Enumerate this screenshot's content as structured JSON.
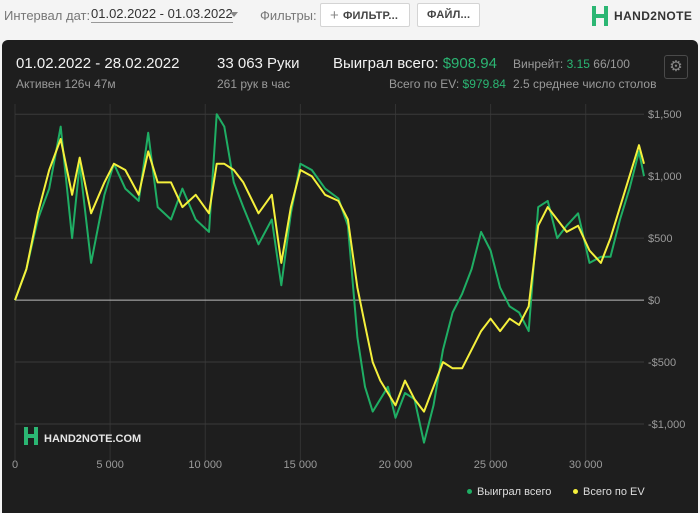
{
  "toolbar": {
    "interval_label": "Интервал дат:",
    "date_range": "01.02.2022 - 01.03.2022",
    "filters_label": "Фильтры:",
    "filter_button": "ФИЛЬТР...",
    "files_button": "ФАЙЛ...",
    "logo_text": "HAND2NOTE"
  },
  "stats": {
    "period": "01.02.2022 - 28.02.2022",
    "active": "Активен 126ч 47м",
    "hands": "33 063 Руки",
    "hands_per_hour": "261 рук в час",
    "won_label": "Выиграл всего:",
    "won_value": "$908.94",
    "ev_label": "Всего по EV:",
    "ev_value": "$979.84",
    "winrate_label": "Винрейт:",
    "winrate_value": "3.15",
    "winrate_unit": "66/100",
    "avg_tables": "2.5 среднее число столов"
  },
  "watermark": "HAND2NOTE.COM",
  "legend": {
    "won": "Выиграл всего",
    "ev": "Всего по EV"
  },
  "colors": {
    "won": "#1fae64",
    "ev": "#f5f03c",
    "background": "#1e1e1e"
  },
  "chart_data": {
    "type": "line",
    "xlim": [
      0,
      33063
    ],
    "ylim": [
      -1250,
      1550
    ],
    "x_ticks": [
      0,
      5000,
      10000,
      15000,
      20000,
      25000,
      30000
    ],
    "x_tick_labels": [
      "0",
      "5 000",
      "10 000",
      "15 000",
      "20 000",
      "25 000",
      "30 000"
    ],
    "y_ticks": [
      1500,
      1000,
      500,
      0,
      -500,
      -1000
    ],
    "y_tick_labels": [
      "$1,500",
      "$1,000",
      "$500",
      "$0",
      "-$500",
      "-$1,000"
    ],
    "grid": true,
    "legend_position": "bottom-right",
    "series": [
      {
        "name": "Выиграл всего",
        "x": [
          0,
          600,
          1200,
          1800,
          2400,
          3000,
          3400,
          4000,
          4700,
          5200,
          5800,
          6500,
          7000,
          7500,
          8200,
          8800,
          9500,
          10200,
          10600,
          11000,
          11500,
          12000,
          12800,
          13500,
          14000,
          14500,
          15000,
          15600,
          16300,
          17000,
          17500,
          18000,
          18400,
          18800,
          19200,
          19600,
          20000,
          20500,
          21000,
          21500,
          22000,
          22500,
          23000,
          23500,
          24000,
          24500,
          25000,
          25500,
          26000,
          26500,
          27000,
          27500,
          28000,
          28500,
          29000,
          29600,
          30200,
          30800,
          31300,
          31800,
          32300,
          32800,
          33063
        ],
        "values": [
          0,
          250,
          650,
          900,
          1400,
          500,
          1100,
          300,
          850,
          1100,
          900,
          800,
          1350,
          750,
          650,
          900,
          650,
          550,
          1500,
          1400,
          950,
          750,
          450,
          650,
          120,
          700,
          1100,
          1050,
          900,
          820,
          600,
          -300,
          -700,
          -900,
          -800,
          -700,
          -950,
          -750,
          -800,
          -1150,
          -850,
          -400,
          -100,
          50,
          250,
          550,
          400,
          100,
          -50,
          -100,
          -250,
          750,
          800,
          500,
          600,
          700,
          300,
          350,
          350,
          650,
          900,
          1200,
          1000
        ]
      },
      {
        "name": "Всего по EV",
        "x": [
          0,
          600,
          1200,
          1800,
          2400,
          3000,
          3400,
          4000,
          4700,
          5200,
          5800,
          6500,
          7000,
          7500,
          8200,
          8800,
          9500,
          10200,
          10600,
          11000,
          11500,
          12000,
          12800,
          13500,
          14000,
          14500,
          15000,
          15600,
          16300,
          17000,
          17500,
          18000,
          18400,
          18800,
          19200,
          19600,
          20000,
          20500,
          21000,
          21500,
          22000,
          22500,
          23000,
          23500,
          24000,
          24500,
          25000,
          25500,
          26000,
          26500,
          27000,
          27500,
          28000,
          28500,
          29000,
          29600,
          30200,
          30800,
          31300,
          31800,
          32300,
          32800,
          33063
        ],
        "values": [
          0,
          250,
          700,
          1050,
          1300,
          850,
          1150,
          700,
          950,
          1100,
          1050,
          850,
          1200,
          950,
          950,
          750,
          850,
          700,
          1100,
          1100,
          1050,
          950,
          700,
          850,
          300,
          750,
          1050,
          1000,
          850,
          800,
          650,
          100,
          -200,
          -500,
          -650,
          -750,
          -850,
          -650,
          -800,
          -900,
          -700,
          -500,
          -550,
          -550,
          -400,
          -250,
          -150,
          -250,
          -150,
          -200,
          -50,
          600,
          750,
          650,
          550,
          600,
          400,
          300,
          500,
          750,
          1000,
          1250,
          1100
        ]
      }
    ]
  }
}
